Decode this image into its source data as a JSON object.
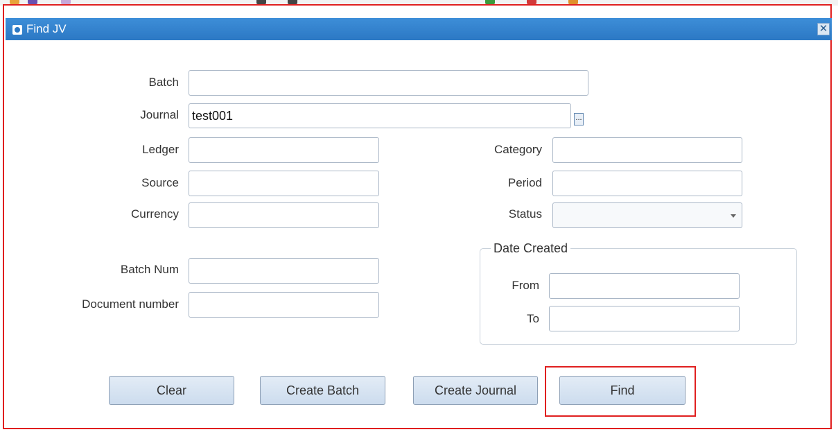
{
  "dialog": {
    "title": "Find JV",
    "close_glyph": "✕"
  },
  "fields": {
    "batch": {
      "label": "Batch",
      "value": ""
    },
    "journal": {
      "label": "Journal",
      "value": "test001",
      "lov_glyph": "..."
    },
    "ledger": {
      "label": "Ledger",
      "value": ""
    },
    "source": {
      "label": "Source",
      "value": ""
    },
    "currency": {
      "label": "Currency",
      "value": ""
    },
    "batch_num": {
      "label": "Batch Num",
      "value": ""
    },
    "document_number": {
      "label": "Document number",
      "value": ""
    },
    "category": {
      "label": "Category",
      "value": ""
    },
    "period": {
      "label": "Period",
      "value": ""
    },
    "status": {
      "label": "Status",
      "value": ""
    }
  },
  "date_created": {
    "legend": "Date Created",
    "from": {
      "label": "From",
      "value": ""
    },
    "to": {
      "label": "To",
      "value": ""
    }
  },
  "buttons": {
    "clear": "Clear",
    "create_batch": "Create Batch",
    "create_journal": "Create Journal",
    "find": "Find"
  },
  "colors": {
    "title_bar": "#2c78c4",
    "highlight": "#e01f1f",
    "button_face": "#d6e3f1"
  },
  "icons": [
    "toolbar-icons",
    "app-icon",
    "close-icon",
    "list-of-values-icon",
    "dropdown-arrow-icon"
  ]
}
